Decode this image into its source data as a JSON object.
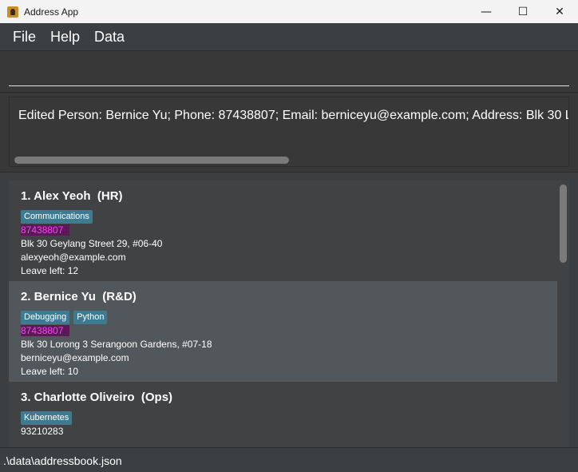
{
  "window": {
    "title": "Address App",
    "minimize_icon": "—",
    "maximize_icon": "☐",
    "close_icon": "✕"
  },
  "menu": {
    "items": [
      "File",
      "Help",
      "Data"
    ]
  },
  "command": {
    "value": "",
    "placeholder": ""
  },
  "result": {
    "text": "Edited Person: Bernice Yu; Phone: 87438807; Email: berniceyu@example.com; Address: Blk 30 L"
  },
  "persons": [
    {
      "name": "1. Alex Yeoh",
      "department": "(HR)",
      "tags": [
        "Communications"
      ],
      "phone": "87438807",
      "address": "Blk 30 Geylang Street 29, #06-40",
      "email": "alexyeoh@example.com",
      "leave": "Leave left: 12"
    },
    {
      "name": "2. Bernice Yu",
      "department": "(R&D)",
      "tags": [
        "Debugging",
        "Python"
      ],
      "phone": "87438807",
      "address": "Blk 30 Lorong 3 Serangoon Gardens, #07-18",
      "email": "berniceyu@example.com",
      "leave": "Leave left: 10"
    },
    {
      "name": "3. Charlotte Oliveiro",
      "department": "(Ops)",
      "tags": [
        "Kubernetes"
      ],
      "phone": "93210283",
      "address": "",
      "email": "",
      "leave": ""
    }
  ],
  "status": {
    "path": ".\\data\\addressbook.json"
  },
  "colors": {
    "tag": "#3e7b91",
    "selected_card": "#52575b",
    "phone_highlight": "#ff40ff"
  }
}
